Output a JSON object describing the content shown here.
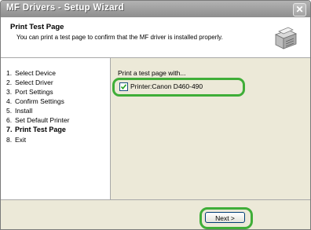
{
  "window": {
    "title": "MF Drivers - Setup Wizard",
    "close_glyph": "✕"
  },
  "header": {
    "title": "Print Test Page",
    "description": "You can print a test page to confirm that the MF driver is installed properly.",
    "icon": "printer-icon"
  },
  "steps": [
    {
      "num": "1.",
      "label": "Select Device",
      "active": false
    },
    {
      "num": "2.",
      "label": "Select Driver",
      "active": false
    },
    {
      "num": "3.",
      "label": "Port Settings",
      "active": false
    },
    {
      "num": "4.",
      "label": "Confirm Settings",
      "active": false
    },
    {
      "num": "5.",
      "label": "Install",
      "active": false
    },
    {
      "num": "6.",
      "label": "Set Default Printer",
      "active": false
    },
    {
      "num": "7.",
      "label": "Print Test Page",
      "active": true
    },
    {
      "num": "8.",
      "label": "Exit",
      "active": false
    }
  ],
  "content": {
    "heading": "Print a test page with...",
    "option": {
      "label": "Printer:Canon D460-490",
      "checked": true
    }
  },
  "footer": {
    "next_label": "Next >"
  },
  "colors": {
    "highlight": "#3fae38",
    "titlebar": "#9e9e9e",
    "panel": "#ece9d8"
  }
}
